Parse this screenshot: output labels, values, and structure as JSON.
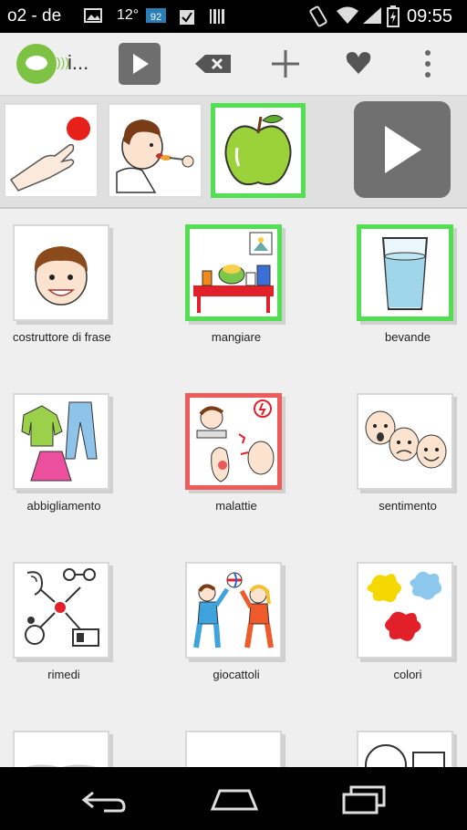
{
  "status_bar": {
    "carrier": "o2 - de",
    "temperature": "12°",
    "badge": "92",
    "time": "09:55"
  },
  "action_bar": {
    "app_title": "i..."
  },
  "categories": [
    {
      "label": "costruttore di frase"
    },
    {
      "label": "mangiare"
    },
    {
      "label": "bevande"
    },
    {
      "label": "abbigliamento"
    },
    {
      "label": "malattie"
    },
    {
      "label": "sentimento"
    },
    {
      "label": "rimedi"
    },
    {
      "label": "giocattoli"
    },
    {
      "label": "colori"
    }
  ],
  "colors": {
    "selected_border": "#52e052",
    "alert_border": "#ef5a5a",
    "play_button": "#707070",
    "brand": "#7dc242"
  }
}
